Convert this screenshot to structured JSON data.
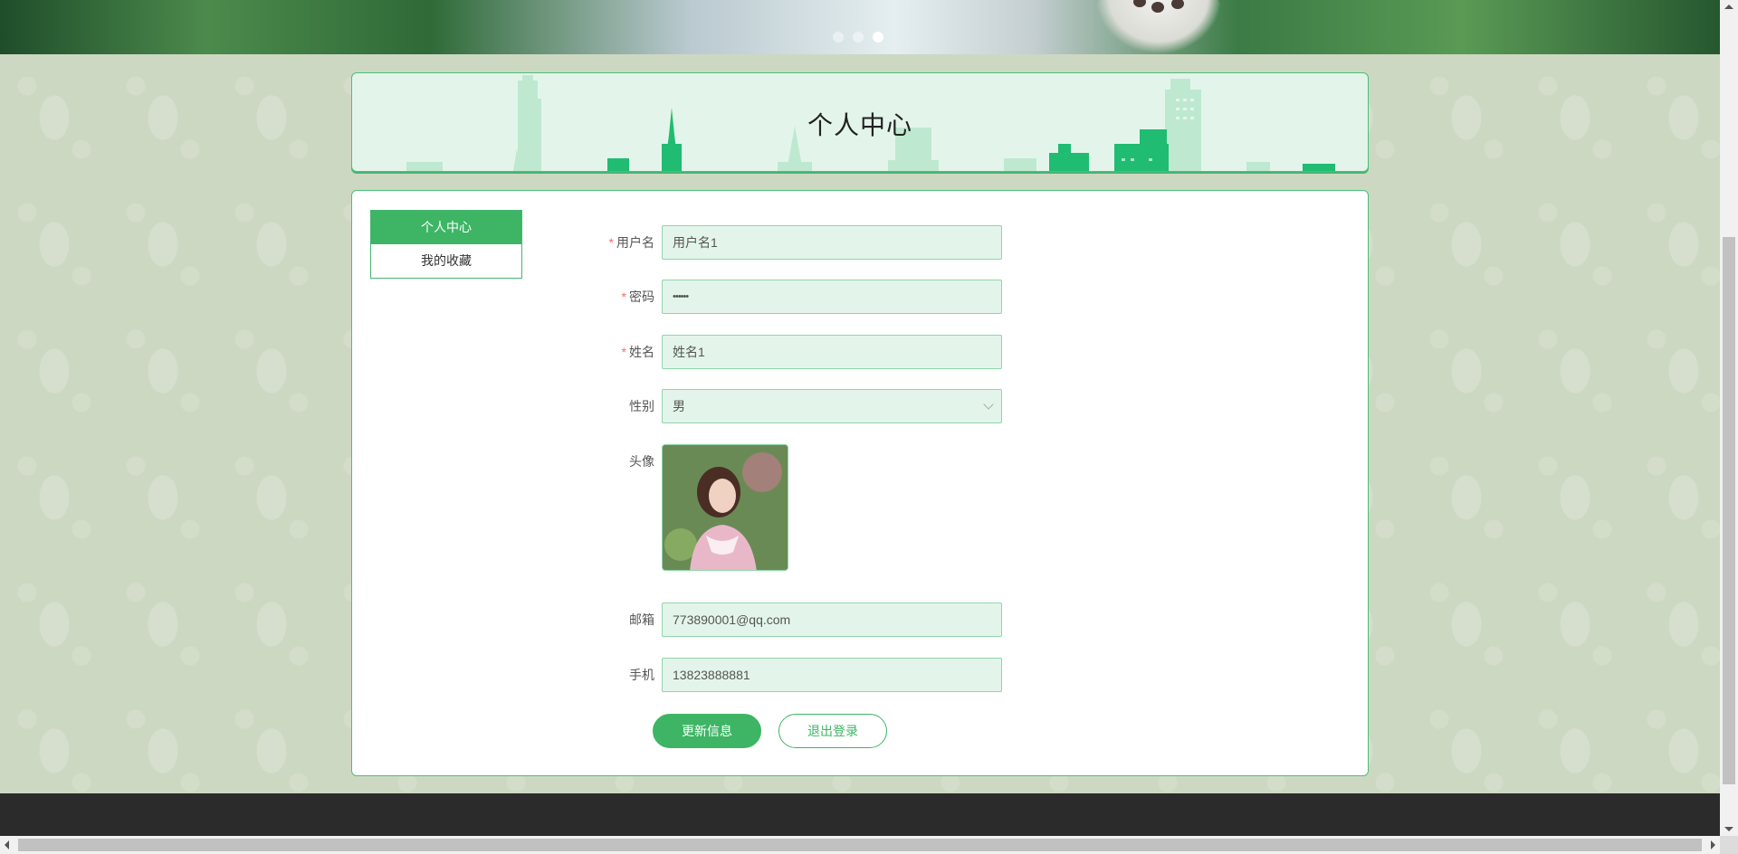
{
  "banner": {
    "slide_count": 3,
    "active_slide": 3
  },
  "header": {
    "title": "个人中心"
  },
  "sidebar": {
    "items": [
      {
        "label": "个人中心",
        "active": true
      },
      {
        "label": "我的收藏",
        "active": false
      }
    ]
  },
  "form": {
    "username": {
      "label": "用户名",
      "required": true,
      "value": "用户名1"
    },
    "password": {
      "label": "密码",
      "required": true,
      "value": "••••••"
    },
    "name": {
      "label": "姓名",
      "required": true,
      "value": "姓名1"
    },
    "gender": {
      "label": "性别",
      "required": false,
      "value": "男"
    },
    "avatar": {
      "label": "头像",
      "required": false
    },
    "email": {
      "label": "邮箱",
      "required": false,
      "value": "773890001@qq.com"
    },
    "phone": {
      "label": "手机",
      "required": false,
      "value": "13823888881"
    }
  },
  "actions": {
    "update_label": "更新信息",
    "logout_label": "退出登录"
  },
  "colors": {
    "accent": "#3db565",
    "input_bg": "#e3f5ea",
    "footer": "#2b2b2b"
  }
}
